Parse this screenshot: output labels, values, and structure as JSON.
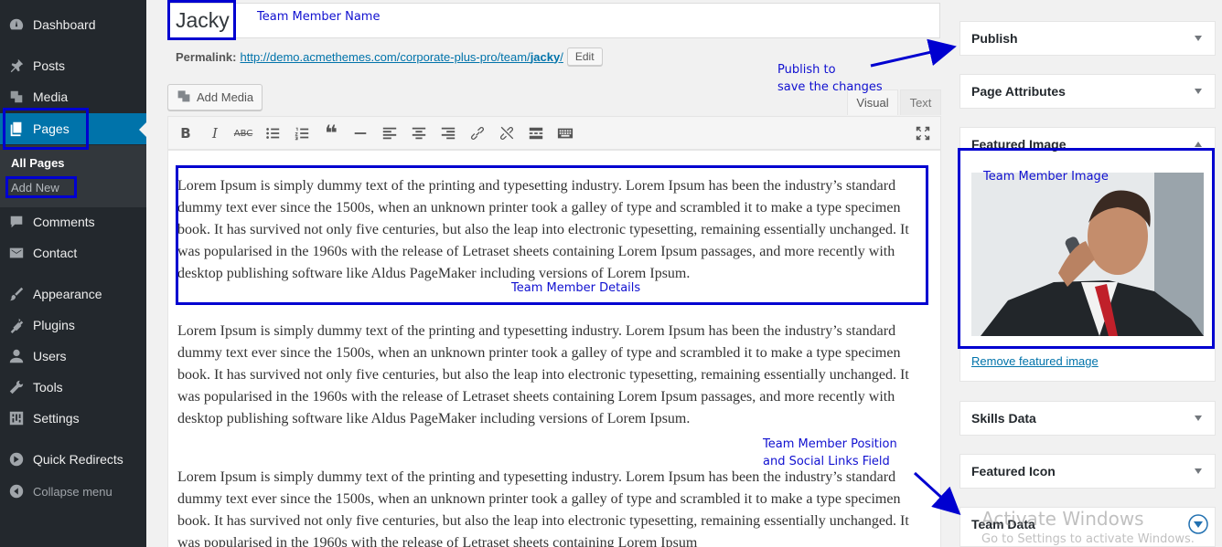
{
  "sidebar": {
    "items": [
      {
        "label": "Dashboard",
        "icon": "dashboard-icon"
      },
      {
        "label": "Posts",
        "icon": "pin-icon"
      },
      {
        "label": "Media",
        "icon": "media-icon"
      },
      {
        "label": "Pages",
        "icon": "pages-icon"
      },
      {
        "label": "Comments",
        "icon": "comment-icon"
      },
      {
        "label": "Contact",
        "icon": "mail-icon"
      },
      {
        "label": "Appearance",
        "icon": "brush-icon"
      },
      {
        "label": "Plugins",
        "icon": "plugin-icon"
      },
      {
        "label": "Users",
        "icon": "user-icon"
      },
      {
        "label": "Tools",
        "icon": "wrench-icon"
      },
      {
        "label": "Settings",
        "icon": "settings-icon"
      },
      {
        "label": "Quick Redirects",
        "icon": "redirect-icon"
      }
    ],
    "submenu": {
      "all_pages": "All Pages",
      "add_new": "Add New"
    },
    "collapse_label": "Collapse menu"
  },
  "editor": {
    "title_value": "Jacky",
    "permalink_label": "Permalink:",
    "permalink_url_base": "http://demo.acmethemes.com/corporate-plus-pro/team/",
    "permalink_slug": "jacky",
    "permalink_url_end": "/",
    "edit_button": "Edit",
    "add_media_label": "Add Media",
    "tab_visual": "Visual",
    "tab_text": "Text",
    "paragraphs": [
      "Lorem Ipsum is simply dummy text of the printing and typesetting industry. Lorem Ipsum has been the industry’s standard dummy text ever since the 1500s, when an unknown printer took a galley of type and scrambled it to make a type specimen book. It has survived not only five centuries, but also the leap into electronic typesetting, remaining essentially unchanged. It was popularised in the 1960s with the release of Letraset sheets containing Lorem Ipsum passages, and more recently with desktop publishing software like Aldus PageMaker including versions of Lorem Ipsum.",
      "Lorem Ipsum is simply dummy text of the printing and typesetting industry. Lorem Ipsum has been the industry’s standard dummy text ever since the 1500s, when an unknown printer took a galley of type and scrambled it to make a type specimen book. It has survived not only five centuries, but also the leap into electronic typesetting, remaining essentially unchanged. It was popularised in the 1960s with the release of Letraset sheets containing Lorem Ipsum passages, and more recently with desktop publishing software like Aldus PageMaker including versions of Lorem Ipsum.",
      "Lorem Ipsum is simply dummy text of the printing and typesetting industry. Lorem Ipsum has been the industry’s standard dummy text ever since the 1500s, when an unknown printer took a galley of type and scrambled it to make a type specimen book. It has survived not only five centuries, but also the leap into electronic typesetting, remaining essentially unchanged. It was popularised in the 1960s with the release of Letraset sheets containing Lorem Ipsum"
    ]
  },
  "metaboxes": {
    "publish": "Publish",
    "page_attributes": "Page Attributes",
    "featured_image": "Featured Image",
    "remove_featured": "Remove featured image",
    "skills_data": "Skills Data",
    "featured_icon": "Featured Icon",
    "team_data": "Team Data"
  },
  "annotations": {
    "team_member_name": "Team Member Name",
    "publish_line1": "Publish to",
    "publish_line2": "save the changes",
    "team_member_image": "Team Member Image",
    "team_member_details": "Team Member Details",
    "position_line1": "Team Member Position",
    "position_line2": "and Social Links Field"
  },
  "watermark": {
    "line1": "Activate Windows",
    "line2": "Go to Settings to activate Windows."
  },
  "colors": {
    "sidebar_bg": "#23282d",
    "active_bg": "#0073aa",
    "annotation": "#0000d0",
    "link": "#0073aa"
  }
}
